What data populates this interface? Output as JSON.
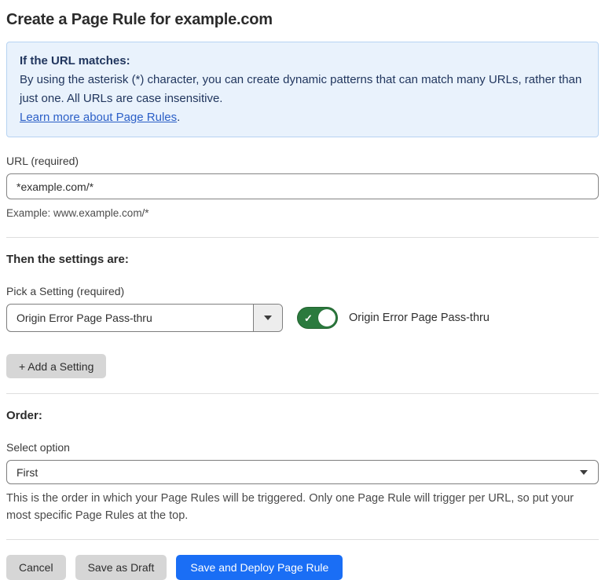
{
  "page": {
    "title": "Create a Page Rule for example.com"
  },
  "info_box": {
    "heading": "If the URL matches:",
    "body": "By using the asterisk (*) character, you can create dynamic patterns that can match many URLs, rather than just one. All URLs are case insensitive.",
    "link_text": "Learn more about Page Rules",
    "link_suffix": "."
  },
  "url_field": {
    "label": "URL (required)",
    "value": "*example.com/*",
    "helper": "Example: www.example.com/*"
  },
  "settings_section": {
    "heading": "Then the settings are:",
    "setting_label": "Pick a Setting (required)",
    "setting_value": "Origin Error Page Pass-thru",
    "toggle_label": "Origin Error Page Pass-thru",
    "toggle_state": "on",
    "add_setting_label": "+ Add a Setting"
  },
  "order_section": {
    "heading": "Order:",
    "select_label": "Select option",
    "select_value": "First",
    "helper": "This is the order in which your Page Rules will be triggered. Only one Page Rule will trigger per URL, so put your most specific Page Rules at the top."
  },
  "footer": {
    "cancel_label": "Cancel",
    "save_draft_label": "Save as Draft",
    "save_deploy_label": "Save and Deploy Page Rule"
  },
  "icons": {
    "check": "✓"
  },
  "colors": {
    "info_bg": "#e9f2fc",
    "info_border": "#b7d3f2",
    "info_text": "#21365e",
    "link_blue": "#2b5fc7",
    "toggle_green": "#2b7a3e",
    "primary_blue": "#1a6ef5",
    "button_gray": "#d6d6d6"
  }
}
